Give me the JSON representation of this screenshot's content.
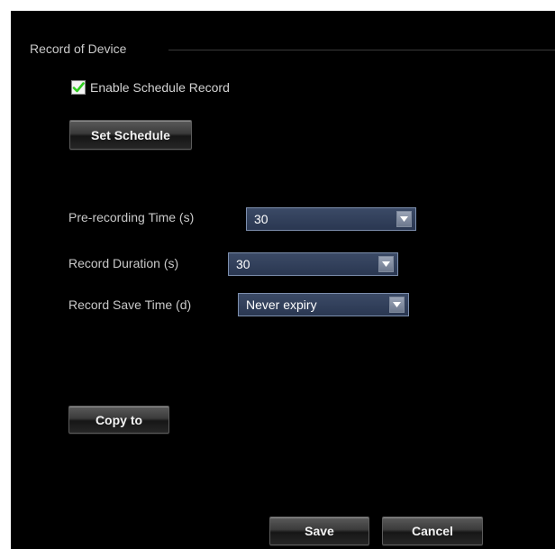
{
  "group": {
    "title": "Record of Device"
  },
  "schedule": {
    "enable_label": "Enable Schedule Record",
    "enable_checked": true,
    "set_schedule_label": "Set Schedule"
  },
  "fields": {
    "pre_recording": {
      "label": "Pre-recording Time (s)",
      "value": "30"
    },
    "record_duration": {
      "label": "Record Duration (s)",
      "value": "30"
    },
    "record_save_time": {
      "label": "Record Save Time (d)",
      "value": "Never expiry"
    }
  },
  "actions": {
    "copy_to_label": "Copy to",
    "save_label": "Save",
    "cancel_label": "Cancel"
  },
  "icons": {
    "checkbox": "checkmark-icon",
    "dropdown": "chevron-down-icon"
  },
  "colors": {
    "panel_background": "#000000",
    "checkmark": "#2ecc1f",
    "select_background": "#2f3c57",
    "select_border": "#7d8fae"
  }
}
